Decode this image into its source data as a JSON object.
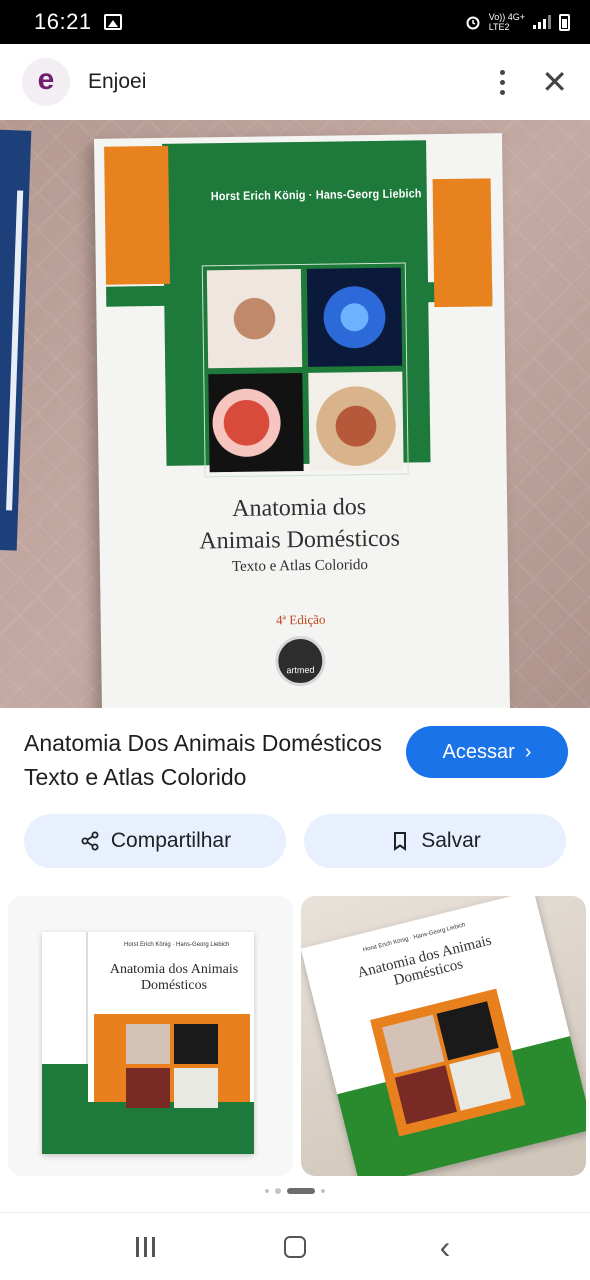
{
  "status_bar": {
    "time": "16:21",
    "net_line1": "Vo)) 4G+",
    "net_line2": "LTE2"
  },
  "header": {
    "logo_letter": "e",
    "site_name": "Enjoei"
  },
  "main_image": {
    "book_authors": "Horst Erich König · Hans-Georg Liebich",
    "book_title_1": "Anatomia dos",
    "book_title_2": "Animais Domésticos",
    "book_subtitle": "Texto e Atlas Colorido",
    "book_edition": "4ª Edição",
    "publisher": "artmed"
  },
  "result": {
    "title": "Anatomia Dos Animais Domésticos Texto e Atlas Colorido",
    "visit_label": "Acessar",
    "share_label": "Compartilhar",
    "save_label": "Salvar"
  },
  "related": [
    {
      "authors": "Horst Erich König · Hans-Georg Liebich",
      "title": "Anatomia dos Animais Domésticos"
    },
    {
      "authors": "Horst Erich König · Hans-Georg Liebich",
      "title": "Anatomia dos Animais Domésticos"
    }
  ],
  "colors": {
    "accent": "#1a73e8",
    "pill_bg": "#e8f0fe",
    "brand": "#70206f"
  },
  "icons": [
    "image-icon",
    "alarm-icon",
    "signal-icon",
    "battery-icon",
    "more-vert-icon",
    "close-icon",
    "lens-icon",
    "chevron-right-icon",
    "share-icon",
    "bookmark-icon",
    "recent-apps-icon",
    "home-icon",
    "back-icon"
  ]
}
